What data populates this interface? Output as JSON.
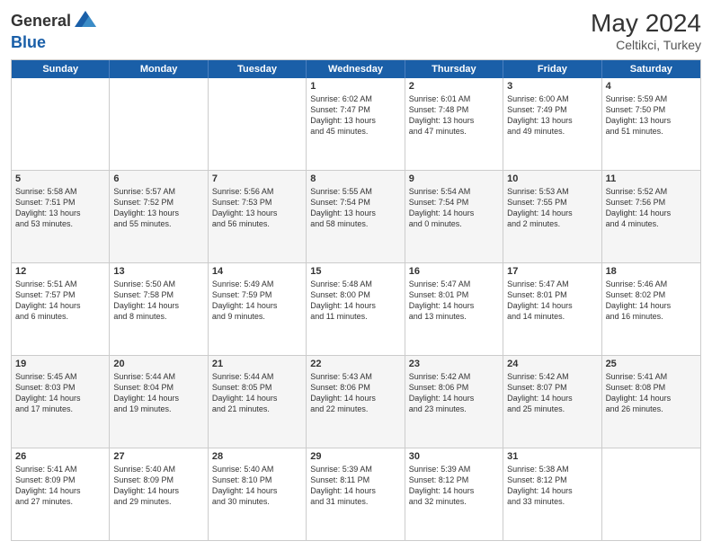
{
  "header": {
    "logo_general": "General",
    "logo_blue": "Blue",
    "month_year": "May 2024",
    "location": "Celtikci, Turkey"
  },
  "weekdays": [
    "Sunday",
    "Monday",
    "Tuesday",
    "Wednesday",
    "Thursday",
    "Friday",
    "Saturday"
  ],
  "rows": [
    [
      {
        "day": "",
        "info": ""
      },
      {
        "day": "",
        "info": ""
      },
      {
        "day": "",
        "info": ""
      },
      {
        "day": "1",
        "info": "Sunrise: 6:02 AM\nSunset: 7:47 PM\nDaylight: 13 hours\nand 45 minutes."
      },
      {
        "day": "2",
        "info": "Sunrise: 6:01 AM\nSunset: 7:48 PM\nDaylight: 13 hours\nand 47 minutes."
      },
      {
        "day": "3",
        "info": "Sunrise: 6:00 AM\nSunset: 7:49 PM\nDaylight: 13 hours\nand 49 minutes."
      },
      {
        "day": "4",
        "info": "Sunrise: 5:59 AM\nSunset: 7:50 PM\nDaylight: 13 hours\nand 51 minutes."
      }
    ],
    [
      {
        "day": "5",
        "info": "Sunrise: 5:58 AM\nSunset: 7:51 PM\nDaylight: 13 hours\nand 53 minutes."
      },
      {
        "day": "6",
        "info": "Sunrise: 5:57 AM\nSunset: 7:52 PM\nDaylight: 13 hours\nand 55 minutes."
      },
      {
        "day": "7",
        "info": "Sunrise: 5:56 AM\nSunset: 7:53 PM\nDaylight: 13 hours\nand 56 minutes."
      },
      {
        "day": "8",
        "info": "Sunrise: 5:55 AM\nSunset: 7:54 PM\nDaylight: 13 hours\nand 58 minutes."
      },
      {
        "day": "9",
        "info": "Sunrise: 5:54 AM\nSunset: 7:54 PM\nDaylight: 14 hours\nand 0 minutes."
      },
      {
        "day": "10",
        "info": "Sunrise: 5:53 AM\nSunset: 7:55 PM\nDaylight: 14 hours\nand 2 minutes."
      },
      {
        "day": "11",
        "info": "Sunrise: 5:52 AM\nSunset: 7:56 PM\nDaylight: 14 hours\nand 4 minutes."
      }
    ],
    [
      {
        "day": "12",
        "info": "Sunrise: 5:51 AM\nSunset: 7:57 PM\nDaylight: 14 hours\nand 6 minutes."
      },
      {
        "day": "13",
        "info": "Sunrise: 5:50 AM\nSunset: 7:58 PM\nDaylight: 14 hours\nand 8 minutes."
      },
      {
        "day": "14",
        "info": "Sunrise: 5:49 AM\nSunset: 7:59 PM\nDaylight: 14 hours\nand 9 minutes."
      },
      {
        "day": "15",
        "info": "Sunrise: 5:48 AM\nSunset: 8:00 PM\nDaylight: 14 hours\nand 11 minutes."
      },
      {
        "day": "16",
        "info": "Sunrise: 5:47 AM\nSunset: 8:01 PM\nDaylight: 14 hours\nand 13 minutes."
      },
      {
        "day": "17",
        "info": "Sunrise: 5:47 AM\nSunset: 8:01 PM\nDaylight: 14 hours\nand 14 minutes."
      },
      {
        "day": "18",
        "info": "Sunrise: 5:46 AM\nSunset: 8:02 PM\nDaylight: 14 hours\nand 16 minutes."
      }
    ],
    [
      {
        "day": "19",
        "info": "Sunrise: 5:45 AM\nSunset: 8:03 PM\nDaylight: 14 hours\nand 17 minutes."
      },
      {
        "day": "20",
        "info": "Sunrise: 5:44 AM\nSunset: 8:04 PM\nDaylight: 14 hours\nand 19 minutes."
      },
      {
        "day": "21",
        "info": "Sunrise: 5:44 AM\nSunset: 8:05 PM\nDaylight: 14 hours\nand 21 minutes."
      },
      {
        "day": "22",
        "info": "Sunrise: 5:43 AM\nSunset: 8:06 PM\nDaylight: 14 hours\nand 22 minutes."
      },
      {
        "day": "23",
        "info": "Sunrise: 5:42 AM\nSunset: 8:06 PM\nDaylight: 14 hours\nand 23 minutes."
      },
      {
        "day": "24",
        "info": "Sunrise: 5:42 AM\nSunset: 8:07 PM\nDaylight: 14 hours\nand 25 minutes."
      },
      {
        "day": "25",
        "info": "Sunrise: 5:41 AM\nSunset: 8:08 PM\nDaylight: 14 hours\nand 26 minutes."
      }
    ],
    [
      {
        "day": "26",
        "info": "Sunrise: 5:41 AM\nSunset: 8:09 PM\nDaylight: 14 hours\nand 27 minutes."
      },
      {
        "day": "27",
        "info": "Sunrise: 5:40 AM\nSunset: 8:09 PM\nDaylight: 14 hours\nand 29 minutes."
      },
      {
        "day": "28",
        "info": "Sunrise: 5:40 AM\nSunset: 8:10 PM\nDaylight: 14 hours\nand 30 minutes."
      },
      {
        "day": "29",
        "info": "Sunrise: 5:39 AM\nSunset: 8:11 PM\nDaylight: 14 hours\nand 31 minutes."
      },
      {
        "day": "30",
        "info": "Sunrise: 5:39 AM\nSunset: 8:12 PM\nDaylight: 14 hours\nand 32 minutes."
      },
      {
        "day": "31",
        "info": "Sunrise: 5:38 AM\nSunset: 8:12 PM\nDaylight: 14 hours\nand 33 minutes."
      },
      {
        "day": "",
        "info": ""
      }
    ]
  ]
}
